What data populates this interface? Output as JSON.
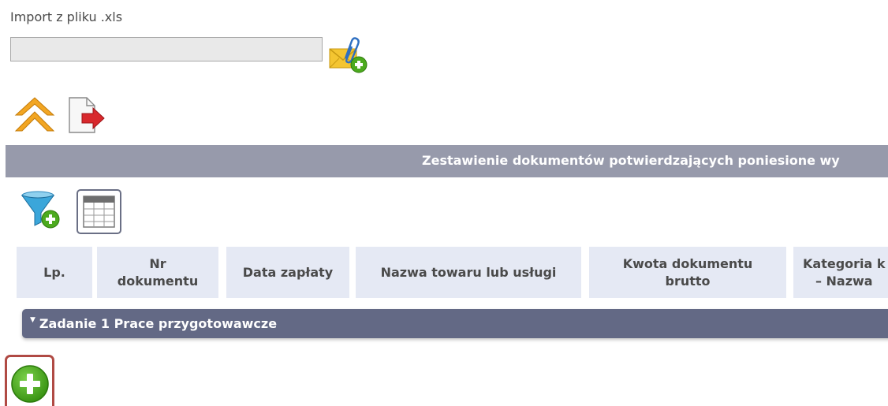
{
  "import": {
    "label": "Import z pliku .xls",
    "value": "",
    "attach_icon": "attach-file-add-icon"
  },
  "toolbar": {
    "up_icon": "double-chevron-up-icon",
    "export_icon": "export-document-icon"
  },
  "section": {
    "title": "Zestawienie dokumentów potwierdzających poniesione wy"
  },
  "table_tools": {
    "filter_icon": "filter-add-icon",
    "columns_icon": "table-columns-icon"
  },
  "columns": [
    "Lp.",
    "Nr\ndokumentu",
    "Data zapłaty",
    "Nazwa towaru lub usługi",
    "Kwota dokumentu\nbrutto",
    "Kategoria k\n– Nazwa"
  ],
  "group": {
    "caret": "▼",
    "label": "Zadanie 1 Prace przygotowawcze"
  },
  "add_button": {
    "icon": "plus-circle-icon"
  },
  "colors": {
    "section_header": "#979aab",
    "column_header_bg": "#e5e9f4",
    "group_bar": "#636985",
    "highlight_border": "#b04a44",
    "add_green": "#4caa1e"
  }
}
